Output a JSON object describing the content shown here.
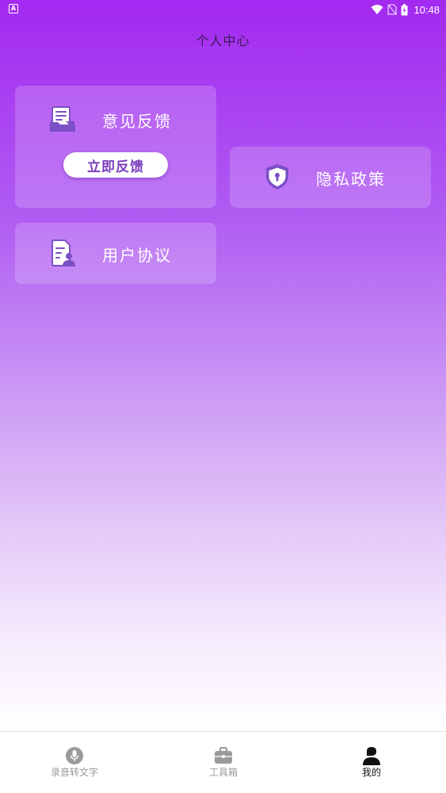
{
  "status_bar": {
    "left_badge": "A",
    "time": "10:48"
  },
  "header": {
    "title": "个人中心"
  },
  "cards": {
    "feedback": {
      "label": "意见反馈",
      "button_label": "立即反馈",
      "icon": "feedback-document-icon"
    },
    "privacy": {
      "label": "隐私政策",
      "icon": "shield-lock-icon"
    },
    "agreement": {
      "label": "用户协议",
      "icon": "user-document-icon"
    }
  },
  "bottom_nav": {
    "items": [
      {
        "label": "录音转文字",
        "icon": "microphone-icon",
        "active": false
      },
      {
        "label": "工具箱",
        "icon": "toolbox-icon",
        "active": false
      },
      {
        "label": "我的",
        "icon": "person-icon",
        "active": true
      }
    ]
  },
  "colors": {
    "gradient_top": "#a329f0",
    "gradient_bottom": "#ffffff",
    "icon_purple": "#7b4fc6",
    "button_text": "#7a3dbd"
  }
}
